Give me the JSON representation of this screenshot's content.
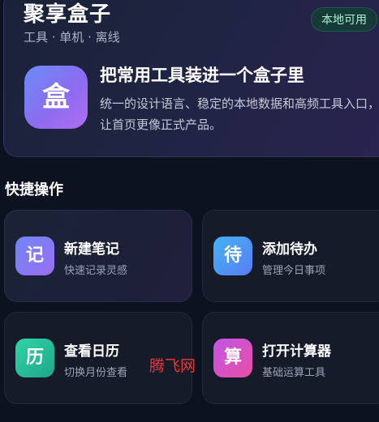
{
  "hero": {
    "title": "聚享盒子",
    "subtitle": "工具 · 单机 · 离线",
    "badge": "本地可用",
    "icon_glyph": "盒",
    "heading": "把常用工具装进一个盒子里",
    "description": "统一的设计语言、稳定的本地数据和高频工具入口，让首页更像正式产品。"
  },
  "quick_actions": {
    "section_title": "快捷操作",
    "items": [
      {
        "glyph": "记",
        "title": "新建笔记",
        "subtitle": "快速记录灵感",
        "icon_color": "#8b77f4"
      },
      {
        "glyph": "待",
        "title": "添加待办",
        "subtitle": "管理今日事项",
        "icon_color": "#4f95f4"
      },
      {
        "glyph": "历",
        "title": "查看日历",
        "subtitle": "切换月份查看",
        "icon_color": "#27bf99"
      },
      {
        "glyph": "算",
        "title": "打开计算器",
        "subtitle": "基础运算工具",
        "icon_color": "#d252c6"
      }
    ]
  },
  "watermark": "腾飞网"
}
